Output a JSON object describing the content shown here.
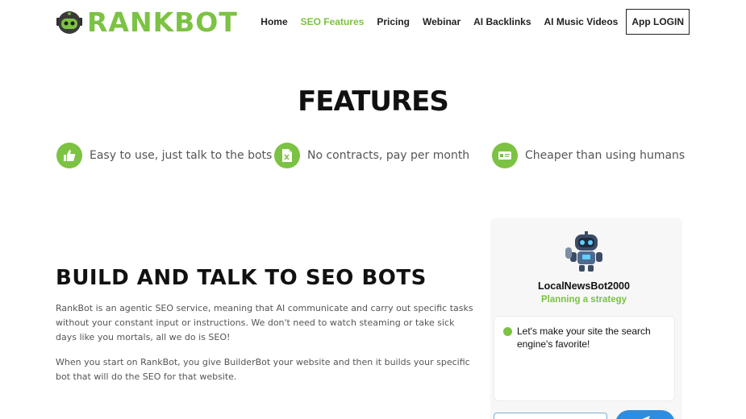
{
  "brand": {
    "name": "RANKBOT",
    "accent": "#7cc243"
  },
  "nav": {
    "items": [
      {
        "label": "Home",
        "active": false
      },
      {
        "label": "SEO Features",
        "active": true
      },
      {
        "label": "Pricing",
        "active": false
      },
      {
        "label": "Webinar",
        "active": false
      },
      {
        "label": "AI Backlinks",
        "active": false
      },
      {
        "label": "AI Music Videos",
        "active": false
      }
    ],
    "login_label": "App LOGIN"
  },
  "features": {
    "title": "FEATURES",
    "items": [
      {
        "icon": "thumbs-up-icon",
        "text": "Easy to use, just talk to the bots"
      },
      {
        "icon": "document-x-icon",
        "text": "No contracts, pay per month"
      },
      {
        "icon": "id-card-icon",
        "text": "Cheaper than using humans"
      }
    ]
  },
  "build": {
    "title": "BUILD AND TALK TO SEO BOTS",
    "paragraph1": "RankBot is an agentic SEO service, meaning that AI communicate and carry out specific tasks without your constant input or instructions. We don't need to watch steaming or take sick days like you mortals, all we do is SEO!",
    "paragraph2": "When you start on RankBot, you give BuilderBot your website and then it builds your specific bot that will do the SEO for that website."
  },
  "bot_card": {
    "name": "LocalNewsBot2000",
    "status": "Planning a strategy",
    "message": "Let's make your site the search engine's favorite!",
    "send_icon": "send-icon",
    "colors": {
      "send_button": "#2d8de0",
      "input_border": "#7ab0d8"
    }
  }
}
